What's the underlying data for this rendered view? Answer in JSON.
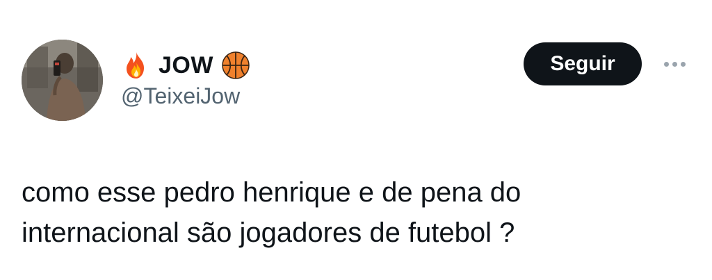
{
  "author": {
    "name": "JOW",
    "handle": "@TeixeiJow",
    "name_prefix_icon": "fire-emoji",
    "name_suffix_icon": "basketball-emoji"
  },
  "actions": {
    "follow_label": "Seguir",
    "more_icon": "more-horizontal-icon"
  },
  "tweet": {
    "lines": [
      "como esse pedro henrique e de pena do",
      "internacional são jogadores de futebol ?"
    ]
  },
  "colors": {
    "text_primary": "#0f1419",
    "text_secondary": "#536471",
    "follow_button_bg": "#0f1419",
    "follow_button_text": "#ffffff",
    "background": "#ffffff"
  }
}
